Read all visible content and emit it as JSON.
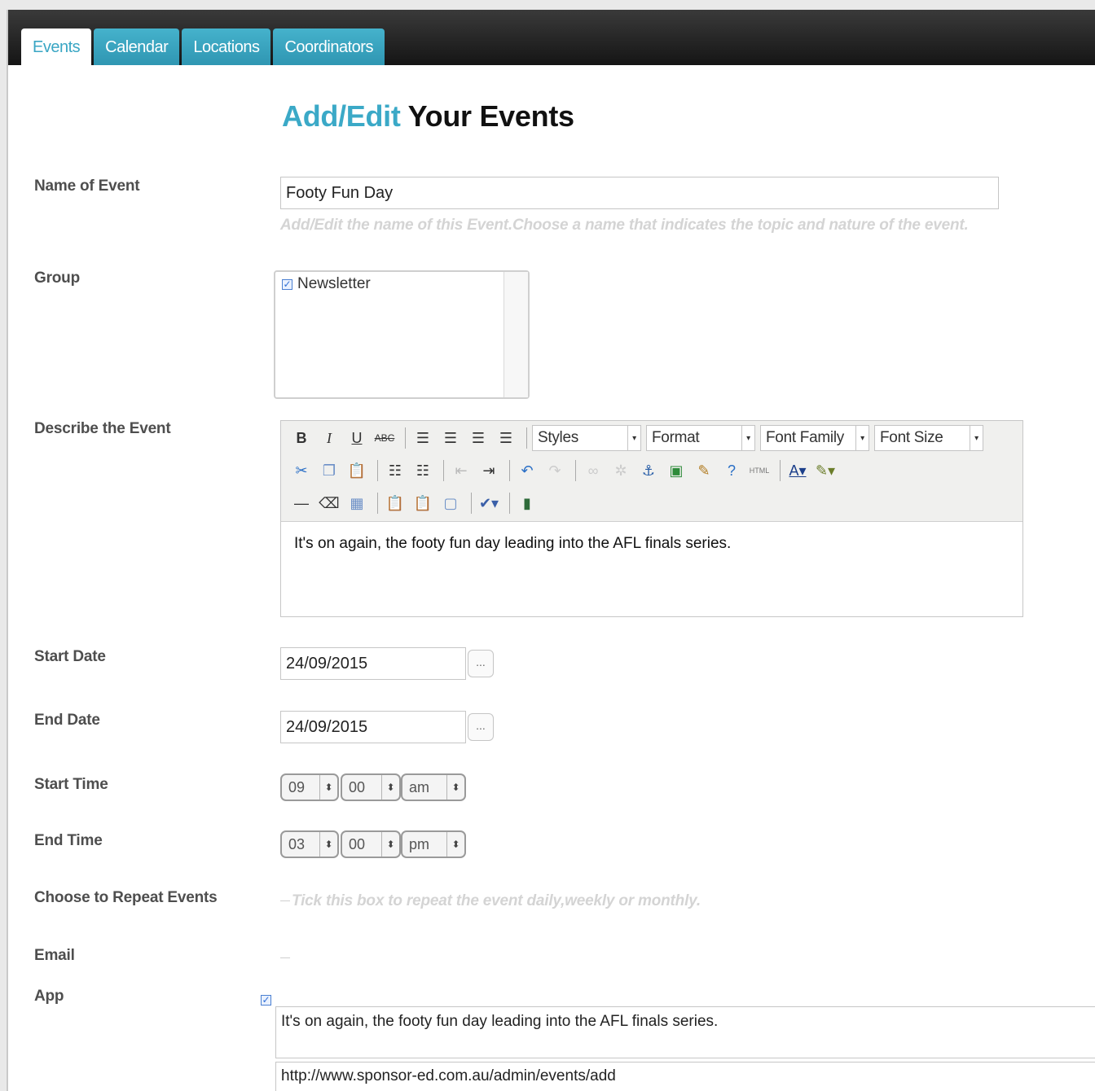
{
  "tabs": [
    {
      "label": "Events",
      "active": true
    },
    {
      "label": "Calendar",
      "active": false
    },
    {
      "label": "Locations",
      "active": false
    },
    {
      "label": "Coordinators",
      "active": false
    }
  ],
  "title": {
    "accent": "Add/Edit",
    "rest": "Your Events"
  },
  "form": {
    "name_label": "Name of Event",
    "name_value": "Footy Fun Day",
    "name_hint": "Add/Edit the name of this Event.Choose a name that indicates the topic and nature of the event.",
    "group_label": "Group",
    "group_item": "Newsletter",
    "describe_label": "Describe the Event",
    "toolbar": {
      "styles": "Styles",
      "format": "Format",
      "font_family": "Font Family",
      "font_size": "Font Size"
    },
    "description": "It's on again, the footy fun day leading into the AFL finals series.",
    "start_date_label": "Start Date",
    "start_date": "24/09/2015",
    "end_date_label": "End Date",
    "end_date": "24/09/2015",
    "calendar_button": "...",
    "start_time_label": "Start Time",
    "start_time": {
      "hour": "09",
      "minute": "00",
      "ampm": "am"
    },
    "end_time_label": "End Time",
    "end_time": {
      "hour": "03",
      "minute": "00",
      "ampm": "pm"
    },
    "repeat_label": "Choose to Repeat Events",
    "repeat_hint": "Tick this box to repeat the event daily,weekly or monthly.",
    "email_label": "Email",
    "app_label": "App",
    "app_description": "It's on again, the footy fun day leading into the AFL finals series.",
    "app_url": "http://www.sponsor-ed.com.au/admin/events/add"
  },
  "colors": {
    "accent": "#3ba9c7",
    "tab": "#3aa6c4",
    "topbar": "#1c1c1c"
  }
}
